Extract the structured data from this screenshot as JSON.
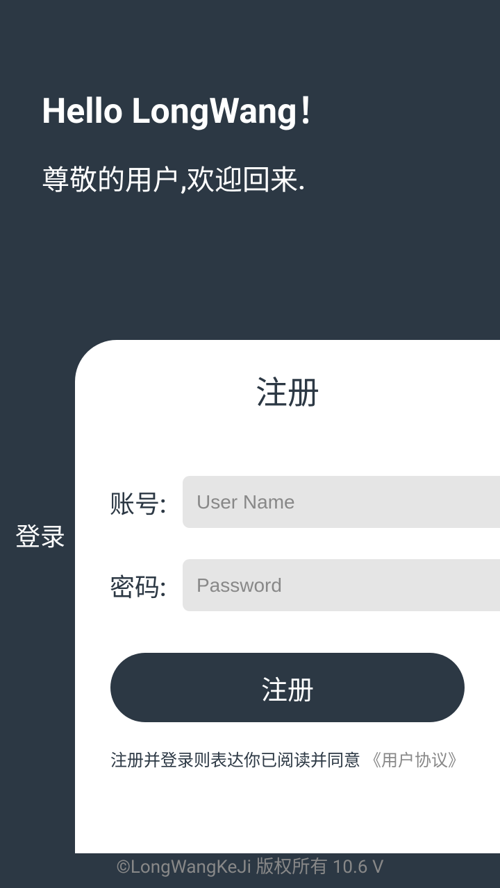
{
  "header": {
    "greeting": "Hello LongWang！",
    "subtitle": "尊敬的用户,欢迎回来."
  },
  "tabs": {
    "login": "登录",
    "register": "注册"
  },
  "form": {
    "username_label": "账号:",
    "username_placeholder": "User Name",
    "password_label": "密码:",
    "password_placeholder": "Password",
    "submit_label": "注册"
  },
  "agreement": {
    "prefix": "注册并登录则表达你已阅读并同意",
    "link": "《用户协议》"
  },
  "footer": {
    "copyright": "©LongWangKeJi 版权所有 10.6 V"
  }
}
